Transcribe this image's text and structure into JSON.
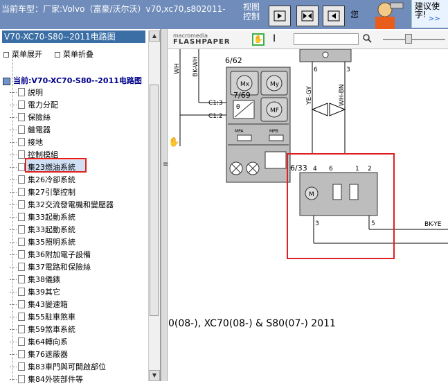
{
  "topbar": {
    "title": "当前车型：厂家:Volvo（富豪/沃尔沃）v70,xc70,s802011-",
    "view_control": "视图控制",
    "helper_text": "您",
    "banner_line1": "建议使",
    "banner_line2": "字!",
    "banner_link": ">>"
  },
  "left_panel": {
    "title": "V70-XC70-S80--2011电路图",
    "expand_label": "菜单展开",
    "collapse_label": "菜单折叠",
    "root_label": "当前:V70-XC70-S80--2011电路图",
    "items": [
      {
        "label": "説明"
      },
      {
        "label": "電力分配"
      },
      {
        "label": "保險絲"
      },
      {
        "label": "繼電器"
      },
      {
        "label": "接地"
      },
      {
        "label": "控制模組"
      },
      {
        "label": "集23燃油系統"
      },
      {
        "label": "集26冷卻系統"
      },
      {
        "label": "集27引擎控制"
      },
      {
        "label": "集32交流發電機和變壓器"
      },
      {
        "label": "集33起動系統"
      },
      {
        "label": "集33起動系統"
      },
      {
        "label": "集35照明系統"
      },
      {
        "label": "集36附加電子設備"
      },
      {
        "label": "集37電路和保險絲"
      },
      {
        "label": "集38儀錶"
      },
      {
        "label": "集39其它"
      },
      {
        "label": "集43變速箱"
      },
      {
        "label": "集55駐車煞車"
      },
      {
        "label": "集59煞車系統"
      },
      {
        "label": "集64轉向系"
      },
      {
        "label": "集76遮蔽器"
      },
      {
        "label": "集83車門與可開啟部位"
      },
      {
        "label": "集84外裝部件等"
      }
    ]
  },
  "flashpaper": {
    "logo_top": "macromedia",
    "logo_bottom": "FLASHPAPER",
    "text_tool": "I"
  },
  "diagram": {
    "label_662": "6/62",
    "label_769": "7/69",
    "label_633": "6/33",
    "wire_wh": "WH",
    "wire_bkwh": "BK-WH",
    "wire_yegy": "YE-GY",
    "wire_whbn": "WH-BN",
    "wire_bkye": "BK-YE",
    "c13": "C1:3",
    "c12": "C1:2",
    "pin6": "6",
    "pin3": "3",
    "pin4": "4",
    "pin6b": "6",
    "pin1": "1",
    "pin2": "2",
    "pin3b": "3",
    "pin5": "5",
    "theta": "θ",
    "mx": "Mx",
    "my": "My",
    "mf": "MF",
    "m": "M",
    "mpa": "MPA",
    "mpb": "MPB",
    "footer": "0(08-), XC70(08-) & S80(07-) 2011"
  }
}
